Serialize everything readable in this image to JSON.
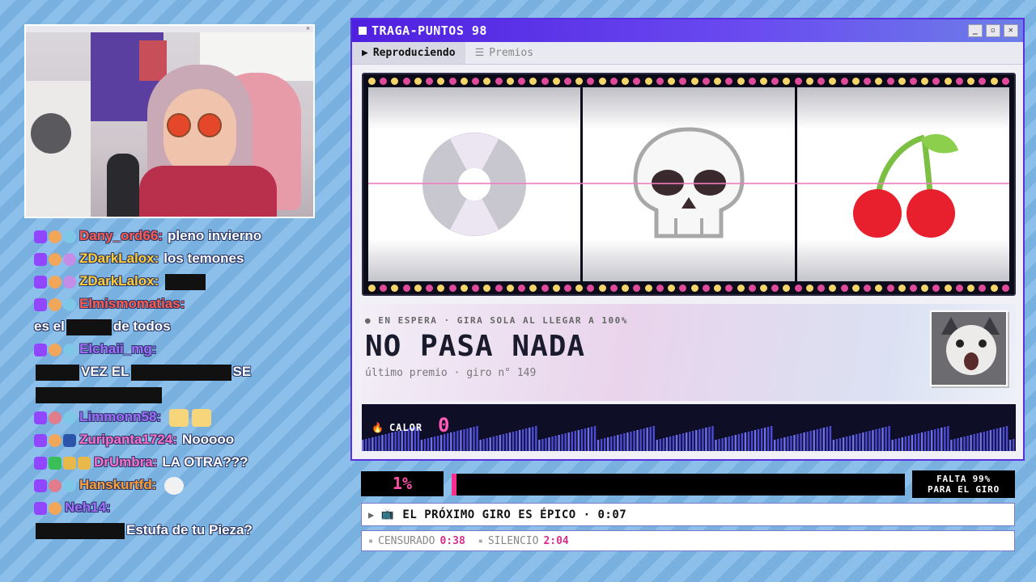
{
  "window": {
    "title": "TRAGA-PUNTOS 98",
    "minimize": "_",
    "maximize": "▫",
    "close": "✕"
  },
  "tabs": [
    {
      "label": "Reproduciendo",
      "icon": "play-icon",
      "glyph": "▶"
    },
    {
      "label": "Premios",
      "icon": "list-icon",
      "glyph": "☰"
    }
  ],
  "reels": [
    "record-disc",
    "skull",
    "cherries"
  ],
  "status": {
    "line": "● EN ESPERA · GIRA SOLA AL LLEGAR A 100%",
    "title": "NO PASA NADA",
    "subtitle": "último premio · giro n° 149"
  },
  "heat": {
    "label": "CALOR",
    "value": "0"
  },
  "progress": {
    "percent_label": "1%",
    "fraction": 0.01,
    "remaining_line1": "FALTA 99%",
    "remaining_line2": "PARA EL GIRO"
  },
  "next_spin": {
    "text": "EL PRÓXIMO GIRO ES ÉPICO · 0:07"
  },
  "timers": [
    {
      "label": "CENSURADO",
      "value": "0:38"
    },
    {
      "label": "SILENCIO",
      "value": "2:04"
    }
  ],
  "colors": {
    "accent": "#5b2ee0",
    "pink": "#ff2d8f",
    "chat_outline": "#2b3a6a"
  },
  "chat": [
    {
      "user": "Dany_ord66:",
      "color": "red",
      "badges": [
        "twitch",
        "crown",
        "eyes"
      ],
      "text": "pleno invierno"
    },
    {
      "user": "ZDarkLalox:",
      "color": "gold",
      "badges": [
        "twitch",
        "crown",
        "eyes-p"
      ],
      "text": "los temones"
    },
    {
      "user": "ZDarkLalox:",
      "color": "gold",
      "badges": [
        "twitch",
        "crown",
        "eyes-p"
      ],
      "text": ""
    },
    {
      "user": "Elmismomatias:",
      "color": "red",
      "badges": [
        "twitch",
        "crown",
        "eyes"
      ],
      "text": ""
    },
    {
      "user": "",
      "color": "",
      "badges": [],
      "text_a": "es el",
      "text_b": "de todos"
    },
    {
      "user": "Elchaii_mg:",
      "color": "purple",
      "badges": [
        "twitch",
        "crown",
        "eyes"
      ],
      "text": ""
    },
    {
      "user": "",
      "color": "",
      "badges": [],
      "text_a": "VEZ EL",
      "text_b": "SE"
    },
    {
      "user": "Limmonn58:",
      "color": "purple",
      "badges": [
        "twitch",
        "wolf",
        "eyes"
      ],
      "text": ""
    },
    {
      "user": "Zuripanta1724:",
      "color": "pink",
      "badges": [
        "twitch",
        "crown",
        "a"
      ],
      "text": "Nooooo"
    },
    {
      "user": "DrUmbra:",
      "color": "pink",
      "badges": [
        "twitch",
        "green",
        "gold",
        "gold"
      ],
      "text": "LA OTRA???"
    },
    {
      "user": "Hanskurtfd:",
      "color": "orange",
      "badges": [
        "twitch",
        "wolf",
        "eyes"
      ],
      "text": ""
    },
    {
      "user": "Neh14:",
      "color": "purple",
      "badges": [
        "twitch",
        "crown"
      ],
      "text": ""
    },
    {
      "user": "",
      "color": "",
      "badges": [],
      "text": "Estufa de tu Pieza?"
    }
  ]
}
